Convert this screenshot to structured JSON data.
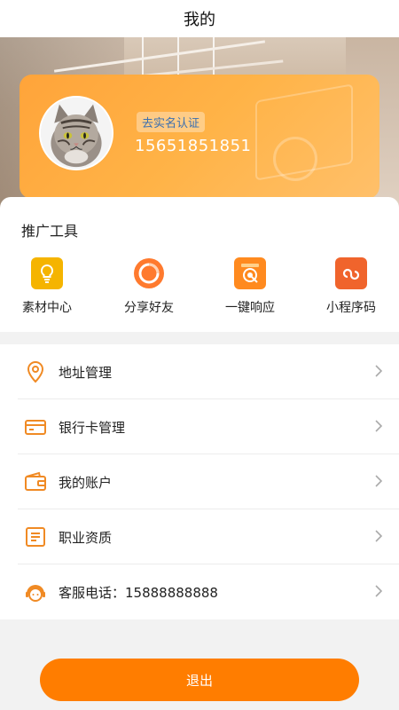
{
  "header": {
    "title": "我的"
  },
  "profile": {
    "verify_label": "去实名认证",
    "phone": "15651851851"
  },
  "tools": {
    "heading": "推广工具",
    "items": [
      {
        "label": "素材中心",
        "icon": "lightbulb-icon",
        "color": "#f5b400"
      },
      {
        "label": "分享好友",
        "icon": "share-circle-icon",
        "color": "#ff7a2e"
      },
      {
        "label": "一键响应",
        "icon": "click-target-icon",
        "color": "#ff8a1f"
      },
      {
        "label": "小程序码",
        "icon": "link-icon",
        "color": "#f0642c"
      }
    ]
  },
  "menu": {
    "items": [
      {
        "label": "地址管理",
        "icon": "location-pin-icon"
      },
      {
        "label": "银行卡管理",
        "icon": "bank-card-icon"
      },
      {
        "label": "我的账户",
        "icon": "wallet-icon"
      },
      {
        "label": "职业资质",
        "icon": "certificate-icon"
      },
      {
        "label": "客服电话：15888888888",
        "icon": "customer-service-icon"
      }
    ]
  },
  "logout": {
    "label": "退出"
  },
  "colors": {
    "accent": "#ff7d00",
    "icon_orange": "#f08a24"
  }
}
